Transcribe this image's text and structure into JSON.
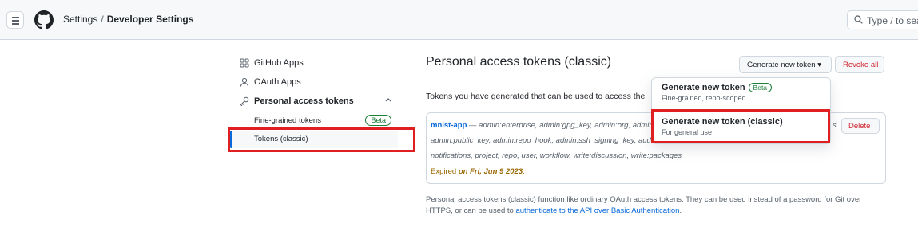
{
  "header": {
    "breadcrumb_root": "Settings",
    "breadcrumb_sep": "/",
    "breadcrumb_current": "Developer Settings",
    "search_placeholder": "Type / to search",
    "menu_icon": "hamburger-icon",
    "logo_icon": "github-logo-icon"
  },
  "sidebar": {
    "items": [
      {
        "label": "GitHub Apps",
        "icon": "apps-icon"
      },
      {
        "label": "OAuth Apps",
        "icon": "person-icon"
      },
      {
        "label": "Personal access tokens",
        "icon": "key-icon"
      }
    ],
    "sub_items": [
      {
        "label": "Fine-grained tokens",
        "badge": "Beta"
      },
      {
        "label": "Tokens (classic)"
      }
    ],
    "expand_icon": "chevron-up-icon"
  },
  "main": {
    "title": "Personal access tokens (classic)",
    "generate_button": "Generate new token ▾",
    "revoke_all_button": "Revoke all",
    "description": "Tokens you have generated that can be used to access the",
    "token": {
      "name": "mnist-app",
      "dash": " — ",
      "scopes_line1": "admin:enterprise, admin:gpg_key, admin:org, admir",
      "scopes_line2": "admin:public_key, admin:repo_hook, admin:ssh_signing_key, audi",
      "scopes_line3": "notifications, project, repo, user, workflow, write:discussion, write:packages",
      "expired_prefix": "Expired",
      "expired_date": "on Fri, Jun 9 2023",
      "expired_suffix": ".",
      "delete_button": "Delete",
      "scope_tail_fragment": "s"
    },
    "footnote_text": "Personal access tokens (classic) function like ordinary OAuth access tokens. They can be used instead of a password for Git over HTTPS, or can be used to ",
    "footnote_link": "authenticate to the API over Basic Authentication",
    "footnote_end": "."
  },
  "dropdown": {
    "items": [
      {
        "title": "Generate new token",
        "badge": "Beta",
        "subtitle": "Fine-grained, repo-scoped"
      },
      {
        "title": "Generate new token (classic)",
        "subtitle": "For general use"
      }
    ]
  },
  "colors": {
    "accent": "#0969da",
    "danger": "#cf222e",
    "success": "#1a7f37",
    "warning": "#9a6700",
    "highlight": "#e02020"
  }
}
